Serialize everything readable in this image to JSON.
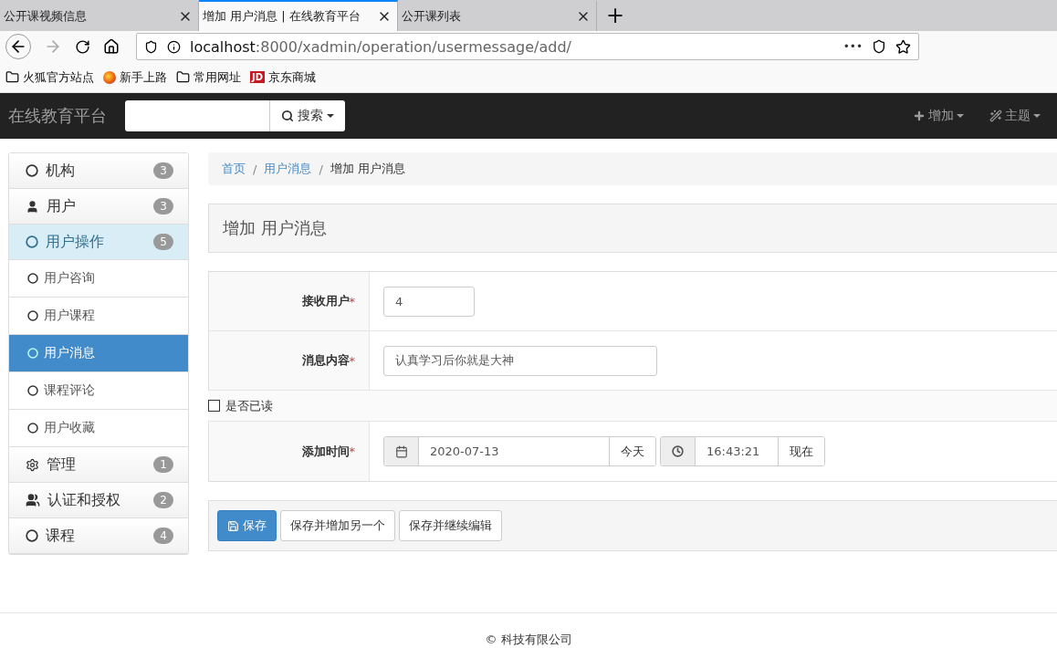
{
  "browser": {
    "tabs": [
      {
        "label": "公开课视频信息",
        "selected": false
      },
      {
        "label": "增加 用户消息 | 在线教育平台",
        "selected": true
      },
      {
        "label": "公开课列表",
        "selected": false
      }
    ],
    "new_tab": "+",
    "address": {
      "host": "localhost",
      "path": ":8000/xadmin/operation/usermessage/add/"
    },
    "more": "•••",
    "bookmarks": [
      {
        "kind": "folder",
        "label": "火狐官方站点"
      },
      {
        "kind": "firefox",
        "label": "新手上路"
      },
      {
        "kind": "folder",
        "label": "常用网址"
      },
      {
        "kind": "jd",
        "label": "京东商城",
        "logo": "JD"
      }
    ]
  },
  "navbar": {
    "brand": "在线教育平台",
    "search_button": "搜索",
    "actions": [
      {
        "kind": "plus",
        "label": "增加"
      },
      {
        "kind": "wand",
        "label": "主题"
      }
    ]
  },
  "sidebar": {
    "items": [
      {
        "kind": "circle",
        "label": "机构",
        "badge": "3",
        "expanded": false
      },
      {
        "kind": "user",
        "label": "用户",
        "badge": "3",
        "expanded": false
      },
      {
        "kind": "circle",
        "label": "用户操作",
        "badge": "5",
        "expanded": true,
        "children": [
          {
            "label": "用户咨询",
            "selected": false
          },
          {
            "label": "用户课程",
            "selected": false
          },
          {
            "label": "用户消息",
            "selected": true
          },
          {
            "label": "课程评论",
            "selected": false
          },
          {
            "label": "用户收藏",
            "selected": false
          }
        ]
      },
      {
        "kind": "gear",
        "label": "管理",
        "badge": "1",
        "expanded": false
      },
      {
        "kind": "users",
        "label": "认证和授权",
        "badge": "2",
        "expanded": false
      },
      {
        "kind": "circle",
        "label": "课程",
        "badge": "4",
        "expanded": false
      }
    ]
  },
  "breadcrumb": [
    {
      "label": "首页",
      "link": true
    },
    {
      "separator": "/",
      "label": "用户消息",
      "link": true
    },
    {
      "separator": "/",
      "label": "增加 用户消息",
      "link": false
    }
  ],
  "panel_title": "增加 用户消息",
  "form": [
    {
      "kind": "text",
      "label": "接收用户",
      "mark": "*",
      "value": "4"
    },
    {
      "kind": "text",
      "label": "消息内容",
      "mark": "*",
      "value": "认真学习后你就是大神"
    },
    {
      "kind": "checkbox",
      "label": "是否已读",
      "checked": false
    },
    {
      "kind": "datetime",
      "label": "添加时间",
      "mark": "*",
      "date": "2020-07-13",
      "today": "今天",
      "time": "16:43:21",
      "now": "现在"
    }
  ],
  "buttons": [
    {
      "kind": "primary",
      "label": "保存"
    },
    {
      "kind": "default",
      "label": "保存并增加另一个"
    },
    {
      "kind": "default",
      "label": "保存并继续编辑"
    }
  ],
  "footer": "© 科技有限公司"
}
